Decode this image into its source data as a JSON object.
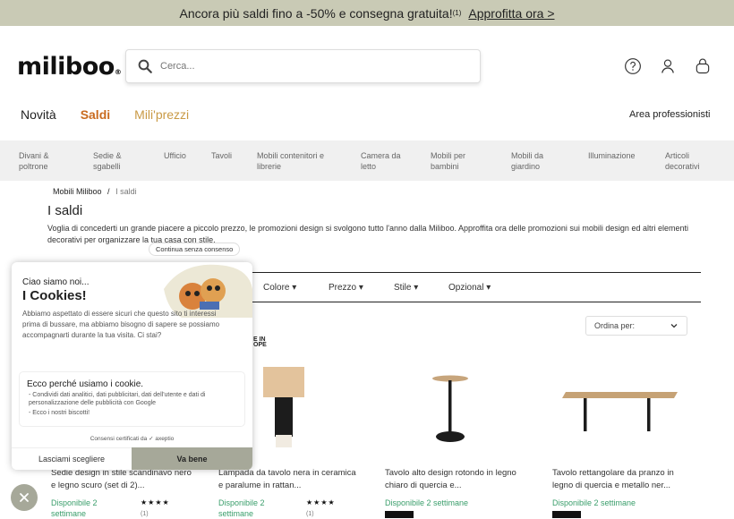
{
  "promo": {
    "text": "Ancora più saldi fino a -50% e consegna gratuita!",
    "sup": "(1)",
    "link": "Approfitta ora >"
  },
  "header": {
    "logo": "miliboo",
    "logo_tm": "®",
    "search_placeholder": "Cerca..."
  },
  "mainnav": {
    "items": [
      "Novità",
      "Saldi",
      "Mili'prezzi"
    ],
    "pro": "Area professionisti"
  },
  "categories": [
    "Divani &\npoltrone",
    "Sedie &\nsgabelli",
    "Ufficio",
    "Tavoli",
    "Mobili contenitori e\nlibrerie",
    "Camera da\nletto",
    "Mobili per\nbambini",
    "Mobili da\ngiardino",
    "Illuminazione",
    "Articoli\ndecorativi"
  ],
  "breadcrumb": {
    "home": "Mobili Miliboo",
    "sep": "/",
    "current": "I saldi"
  },
  "page": {
    "title": "I saldi",
    "description": "Voglia di concederti un grande piacere a piccolo prezzo, le promozioni design si svolgono tutto l'anno dalla Miliboo. Approffita ora delle promozioni sui mobili design ed altri elementi decorativi per organizzare la tua casa con stile."
  },
  "filters": [
    "Colore",
    "Prezzo",
    "Stile",
    "Opzional"
  ],
  "sort": {
    "label": "Ordina per:"
  },
  "madein": {
    "line1": "E IN",
    "line2": "OPE"
  },
  "products": [
    {
      "name": "Sedie design in stile scandinavo nero e legno scuro (set di 2)...",
      "avail": "Disponibile 2 settimane",
      "stars": "★★★★",
      "rc": "(1)"
    },
    {
      "name": "Lampada da tavolo nera in ceramica e paralume in rattan...",
      "avail": "Disponibile 2 settimane",
      "stars": "★★★★",
      "rc": "(1)"
    },
    {
      "name": "Tavolo alto design rotondo in legno chiaro di quercia e...",
      "avail": "Disponibile 2 settimane"
    },
    {
      "name": "Tavolo rettangolare da pranzo in legno di quercia e metallo ner...",
      "avail": "Disponibile 2 settimane"
    }
  ],
  "cookie": {
    "continue": "Continua senza consenso",
    "hi": "Ciao siamo noi...",
    "title": "I Cookies!",
    "body": "Abbiamo aspettato di essere sicuri che questo sito ti interessi prima di bussare, ma abbiamo bisogno di sapere se possiamo accompagnarti durante la tua visita. Ci stai?",
    "why_title": "Ecco perché usiamo i cookie.",
    "why_1": "- Condividi dati analitici, dati pubblicitari, dati dell'utente e dati di personalizzazione delle pubblicità con Google",
    "why_2": "- Ecco i nostri biscotti!",
    "cert": "Consensi certificati da ✓ axeptio",
    "btn_choose": "Lasciami scegliere",
    "btn_ok": "Va bene"
  },
  "colors": {
    "promo_bg": "#c9cab5",
    "saldi": "#c96b1f",
    "milip": "#c99a45",
    "avail": "#3a9e6b",
    "cookie_btn": "#a6a899"
  }
}
